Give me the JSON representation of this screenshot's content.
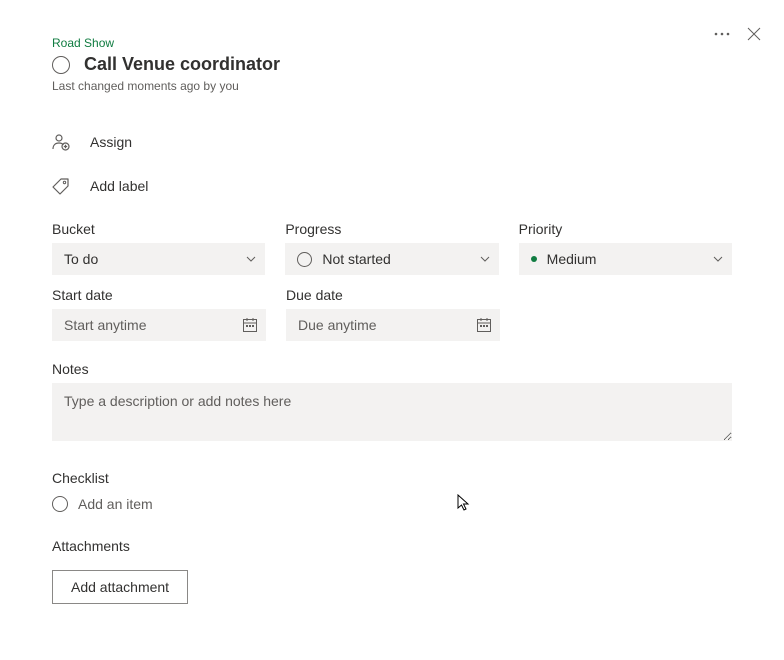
{
  "header": {
    "bucket_link": "Road Show",
    "task_title": "Call Venue coordinator",
    "last_changed": "Last changed moments ago by you"
  },
  "actions": {
    "assign": "Assign",
    "add_label": "Add label"
  },
  "fields": {
    "bucket": {
      "label": "Bucket",
      "value": "To do"
    },
    "progress": {
      "label": "Progress",
      "value": "Not started"
    },
    "priority": {
      "label": "Priority",
      "value": "Medium",
      "color": "#107c41"
    },
    "start_date": {
      "label": "Start date",
      "placeholder": "Start anytime"
    },
    "due_date": {
      "label": "Due date",
      "placeholder": "Due anytime"
    }
  },
  "notes": {
    "label": "Notes",
    "placeholder": "Type a description or add notes here"
  },
  "checklist": {
    "label": "Checklist",
    "add_item": "Add an item"
  },
  "attachments": {
    "label": "Attachments",
    "button": "Add attachment"
  }
}
